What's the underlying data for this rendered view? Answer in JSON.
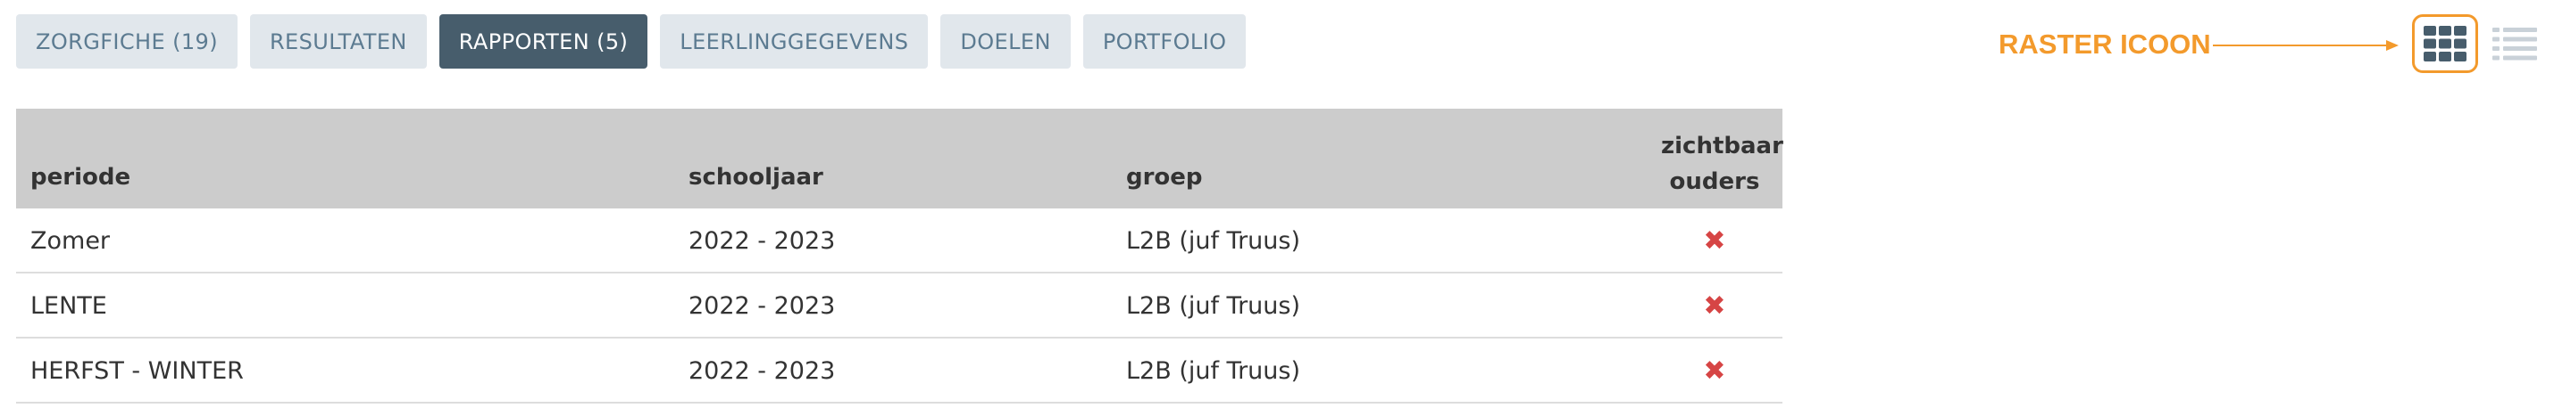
{
  "tabs": [
    {
      "label": "ZORGFICHE (19)",
      "active": false
    },
    {
      "label": "RESULTATEN",
      "active": false
    },
    {
      "label": "RAPPORTEN (5)",
      "active": true
    },
    {
      "label": "LEERLINGGEGEVENS",
      "active": false
    },
    {
      "label": "DOELEN",
      "active": false
    },
    {
      "label": "PORTFOLIO",
      "active": false
    }
  ],
  "annotation": {
    "text": "RASTER ICOON",
    "color": "#f39a2c"
  },
  "view_toggle": {
    "grid_icon": "grid-view-icon",
    "list_icon": "list-view-icon"
  },
  "table": {
    "headers": {
      "periode": "periode",
      "schooljaar": "schooljaar",
      "groep": "groep",
      "zichtbaar_line1": "zichtbaar",
      "zichtbaar_line2": "ouders"
    },
    "rows": [
      {
        "periode": "Zomer",
        "schooljaar": "2022 - 2023",
        "groep": "L2B (juf Truus)",
        "zichtbaar": "✖"
      },
      {
        "periode": "LENTE",
        "schooljaar": "2022 - 2023",
        "groep": "L2B (juf Truus)",
        "zichtbaar": "✖"
      },
      {
        "periode": "HERFST - WINTER",
        "schooljaar": "2022 - 2023",
        "groep": "L2B (juf Truus)",
        "zichtbaar": "✖"
      }
    ]
  },
  "colors": {
    "tab_bg": "#e1e7ec",
    "tab_text": "#5c7b91",
    "tab_active_bg": "#475d6c",
    "header_bg": "#cccccc",
    "not_visible_mark": "#d64545",
    "highlight": "#f39a2c"
  }
}
